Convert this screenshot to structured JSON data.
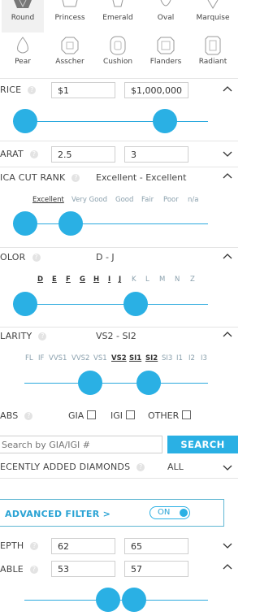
{
  "shapes": {
    "row1": [
      "Round",
      "Princess",
      "Emerald",
      "Oval",
      "Marquise"
    ],
    "row2": [
      "Pear",
      "Asscher",
      "Cushion",
      "Flanders",
      "Radiant"
    ],
    "selected": "Round"
  },
  "price": {
    "label": "RICE",
    "min": "$1",
    "max": "$1,000,000"
  },
  "carat": {
    "label": "ARAT",
    "min": "2.5",
    "max": "3"
  },
  "cut": {
    "label": "ICA CUT RANK",
    "range_text": "Excellent - Excellent",
    "options": [
      "Excellent",
      "Very Good",
      "Good",
      "Fair",
      "Poor",
      "n/a"
    ],
    "selected": [
      "Excellent"
    ]
  },
  "color": {
    "label": "OLOR",
    "range_text": "D - J",
    "options": [
      "D",
      "E",
      "F",
      "G",
      "H",
      "I",
      "J",
      "K",
      "L",
      "M",
      "N",
      "Z"
    ],
    "selected": [
      "D",
      "E",
      "F",
      "G",
      "H",
      "I",
      "J"
    ]
  },
  "clarity": {
    "label": "LARITY",
    "range_text": "VS2 - SI2",
    "options": [
      "FL",
      "IF",
      "VVS1",
      "VVS2",
      "VS1",
      "VS2",
      "SI1",
      "SI2",
      "SI3",
      "I1",
      "I2",
      "I3"
    ],
    "selected": [
      "VS2",
      "SI1",
      "SI2"
    ]
  },
  "labs": {
    "label": "ABS",
    "options": [
      "GIA",
      "IGI",
      "OTHER"
    ]
  },
  "search": {
    "placeholder": "Search by GIA/IGI #",
    "button": "SEARCH"
  },
  "recently_added": {
    "label": "ECENTLY ADDED DIAMONDS",
    "value": "ALL"
  },
  "advanced": {
    "label": "ADVANCED FILTER",
    "chevron": ">",
    "toggle": "ON"
  },
  "depth": {
    "label": "EPTH",
    "min": "62",
    "max": "65"
  },
  "table": {
    "label": "ABLE",
    "min": "53",
    "max": "57"
  },
  "help_glyph": "?",
  "colors": {
    "accent": "#2ab0e4",
    "border": "#cfcfcf",
    "advanced_border": "#5fb6d3",
    "advanced_text": "#2aa3d4"
  }
}
